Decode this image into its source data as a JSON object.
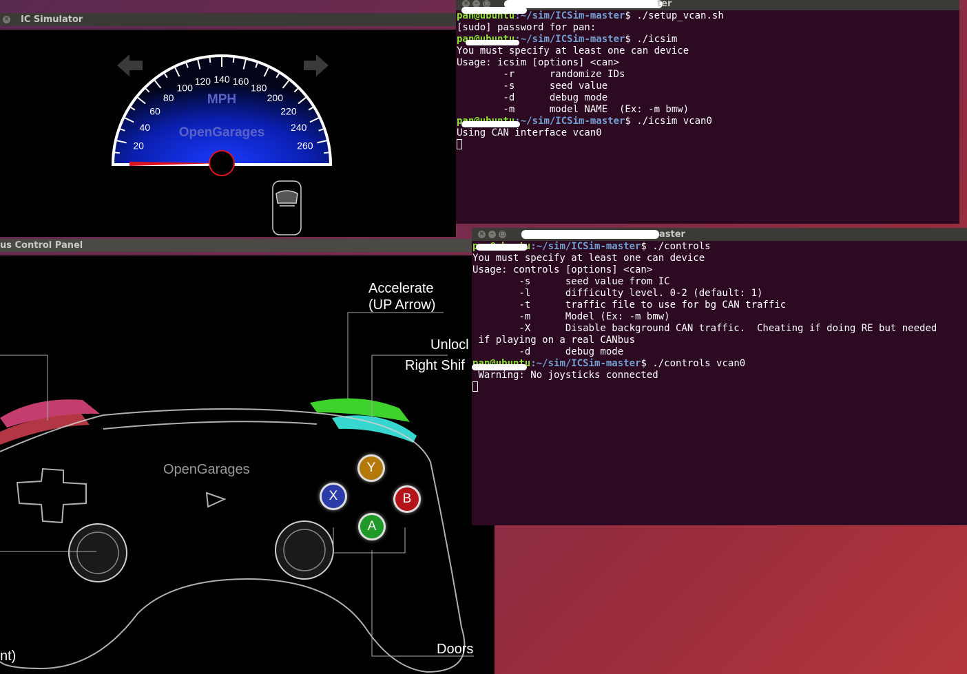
{
  "ic_window": {
    "title": "IC Simulator",
    "speed_unit": "MPH",
    "brand": "OpenGarages",
    "speed_ticks": [
      "20",
      "40",
      "60",
      "80",
      "100",
      "120",
      "140",
      "160",
      "180",
      "200",
      "220",
      "240",
      "260"
    ],
    "speed_needle_value": 0,
    "left_arrow": "turn-left-arrow-icon",
    "right_arrow": "turn-right-arrow-icon"
  },
  "control_window": {
    "title": "us Control Panel",
    "brand": "OpenGarages",
    "labels": {
      "accelerate": "Accelerate",
      "accelerate_sub": "(UP Arrow)",
      "unlock": "Unlocl",
      "right_shift": "Right Shif",
      "doors": "Doors",
      "left_partial": "nt)"
    },
    "buttons": {
      "y": "Y",
      "x": "X",
      "b": "B",
      "a": "A"
    }
  },
  "terminal1": {
    "title": "ter",
    "lines": [
      {
        "prompt": "pan@ubuntu",
        "path": ":~/sim/ICSim-master",
        "cmd": "$ ./setup_vcan.sh"
      },
      {
        "text": "[sudo] password for pan:"
      },
      {
        "prompt": "pan@ubuntu",
        "path": ":~/sim/ICSim-master",
        "cmd": "$ ./icsim"
      },
      {
        "text": "You must specify at least one can device"
      },
      {
        "text": "Usage: icsim [options] <can>"
      },
      {
        "text": "        -r      randomize IDs"
      },
      {
        "text": "        -s      seed value"
      },
      {
        "text": "        -d      debug mode"
      },
      {
        "text": "        -m      model NAME  (Ex: -m bmw)"
      },
      {
        "prompt": "pan@ubuntu",
        "path": ":~/sim/ICSim-master",
        "cmd": "$ ./icsim vcan0"
      },
      {
        "text": "Using CAN interface vcan0"
      }
    ]
  },
  "terminal2": {
    "title": "aster",
    "lines": [
      {
        "prompt": "pan@ubuntu",
        "path": ":~/sim/ICSim-master",
        "cmd": "$ ./controls"
      },
      {
        "text": "You must specify at least one can device"
      },
      {
        "text": "Usage: controls [options] <can>"
      },
      {
        "text": "        -s      seed value from IC"
      },
      {
        "text": "        -l      difficulty level. 0-2 (default: 1)"
      },
      {
        "text": "        -t      traffic file to use for bg CAN traffic"
      },
      {
        "text": "        -m      Model (Ex: -m bmw)"
      },
      {
        "text": "        -X      Disable background CAN traffic.  Cheating if doing RE but needed"
      },
      {
        "text": " if playing on a real CANbus"
      },
      {
        "text": "        -d      debug mode"
      },
      {
        "prompt": "pan@ubuntu",
        "path": ":~/sim/ICSim-master",
        "cmd": "$ ./controls vcan0"
      },
      {
        "text": " Warning: No joysticks connected"
      }
    ]
  },
  "colors": {
    "terminal_bg": "#2c0a22",
    "prompt_green": "#8ae234",
    "path_blue": "#729fcf",
    "needle_red": "#e0141e"
  }
}
